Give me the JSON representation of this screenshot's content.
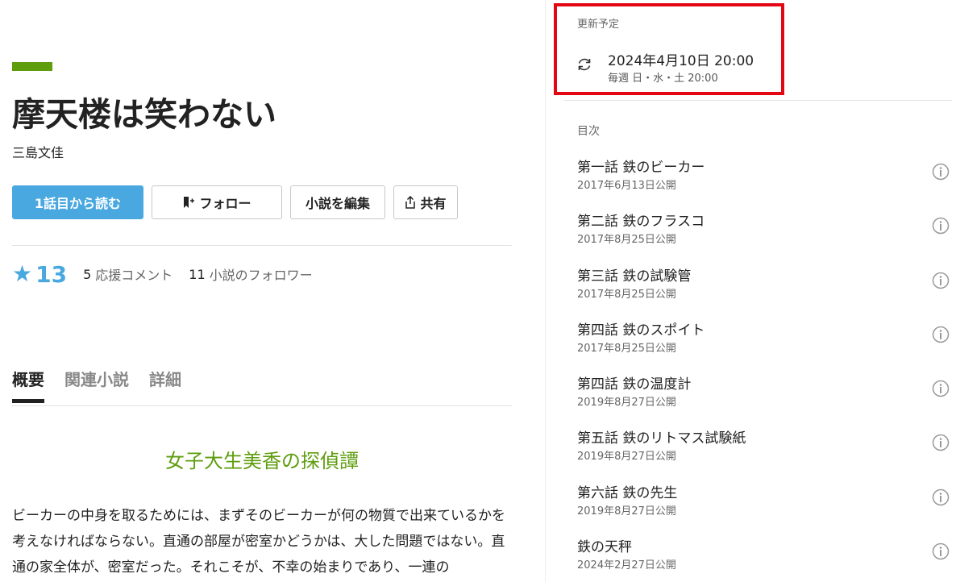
{
  "work": {
    "title": "摩天楼は笑わない",
    "author": "三島文佳"
  },
  "actions": {
    "read_label": "1話目から読む",
    "follow_label": "フォロー",
    "edit_label": "小説を編集",
    "share_label": "共有"
  },
  "stats": {
    "stars": "13",
    "comments_count": "5",
    "comments_label": "応援コメント",
    "followers_count": "11",
    "followers_label": "小説のフォロワー"
  },
  "tabs": [
    {
      "label": "概要"
    },
    {
      "label": "関連小説"
    },
    {
      "label": "詳細"
    }
  ],
  "summary": {
    "catchphrase": "女子大生美香の探偵譚",
    "text": "ビーカーの中身を取るためには、まずそのビーカーが何の物質で出来ているかを考えなければならない。直通の部屋が密室かどうかは、大した問題ではない。直通の家全体が、密室だった。それこそが、不幸の始まりであり、一連の"
  },
  "update": {
    "heading": "更新予定",
    "date": "2024年4月10日 20:00",
    "schedule": "毎週 日・水・土 20:00"
  },
  "toc": {
    "heading": "目次",
    "episodes": [
      {
        "title": "第一話 鉄のビーカー",
        "date": "2017年6月13日公開"
      },
      {
        "title": "第二話 鉄のフラスコ",
        "date": "2017年8月25日公開"
      },
      {
        "title": "第三話 鉄の試験管",
        "date": "2017年8月25日公開"
      },
      {
        "title": "第四話 鉄のスポイト",
        "date": "2017年8月25日公開"
      },
      {
        "title": "第四話 鉄の温度計",
        "date": "2019年8月27日公開"
      },
      {
        "title": "第五話 鉄のリトマス試験紙",
        "date": "2019年8月27日公開"
      },
      {
        "title": "第六話 鉄の先生",
        "date": "2019年8月27日公開"
      },
      {
        "title": "鉄の天秤",
        "date": "2024年2月27日公開"
      }
    ]
  },
  "colors": {
    "accent_green": "#5e9d0e",
    "accent_blue": "#4aa8e1",
    "highlight_red": "#e30613"
  },
  "icons": {
    "star": "star-icon",
    "bookmark": "bookmark-plus-icon",
    "share": "share-icon",
    "refresh": "refresh-icon",
    "info": "info-icon"
  }
}
